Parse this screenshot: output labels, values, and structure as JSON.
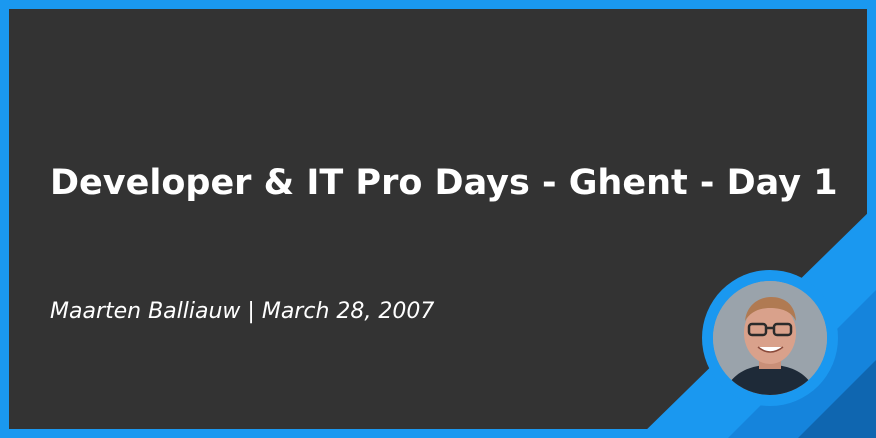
{
  "post": {
    "title": "Developer & IT Pro Days - Ghent - Day 1",
    "author": "Maarten Balliauw",
    "separator": "|",
    "date": "March 28, 2007"
  },
  "colors": {
    "accent": "#1a98f0",
    "accent_dark": "#0f66b0",
    "panel": "#333333",
    "text": "#ffffff"
  },
  "icons": {
    "avatar": "author-photo"
  }
}
